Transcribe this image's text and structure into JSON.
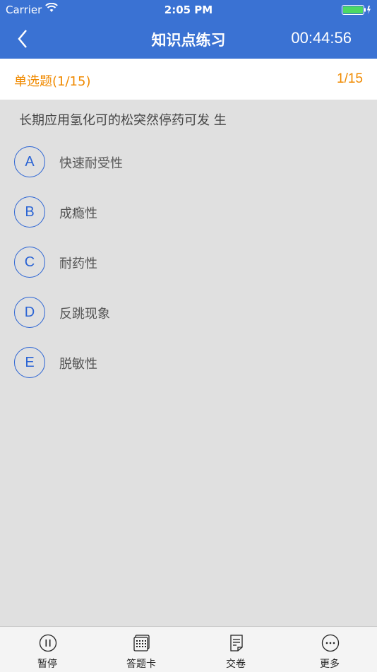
{
  "status_bar": {
    "carrier": "Carrier",
    "time": "2:05 PM",
    "battery_color": "#4cd964"
  },
  "nav": {
    "title": "知识点练习",
    "timer": "00:44:56"
  },
  "question_header": {
    "type_label": "单选题(1/15)",
    "progress": "1/15",
    "accent_color": "#f08a00"
  },
  "question": {
    "text": "长期应用氢化可的松突然停药可发 生",
    "options": [
      {
        "letter": "A",
        "text": "快速耐受性"
      },
      {
        "letter": "B",
        "text": "成瘾性"
      },
      {
        "letter": "C",
        "text": "耐药性"
      },
      {
        "letter": "D",
        "text": "反跳现象"
      },
      {
        "letter": "E",
        "text": "脱敏性"
      }
    ]
  },
  "tabbar": {
    "pause": "暂停",
    "answer_card": "答题卡",
    "submit": "交卷",
    "more": "更多"
  }
}
